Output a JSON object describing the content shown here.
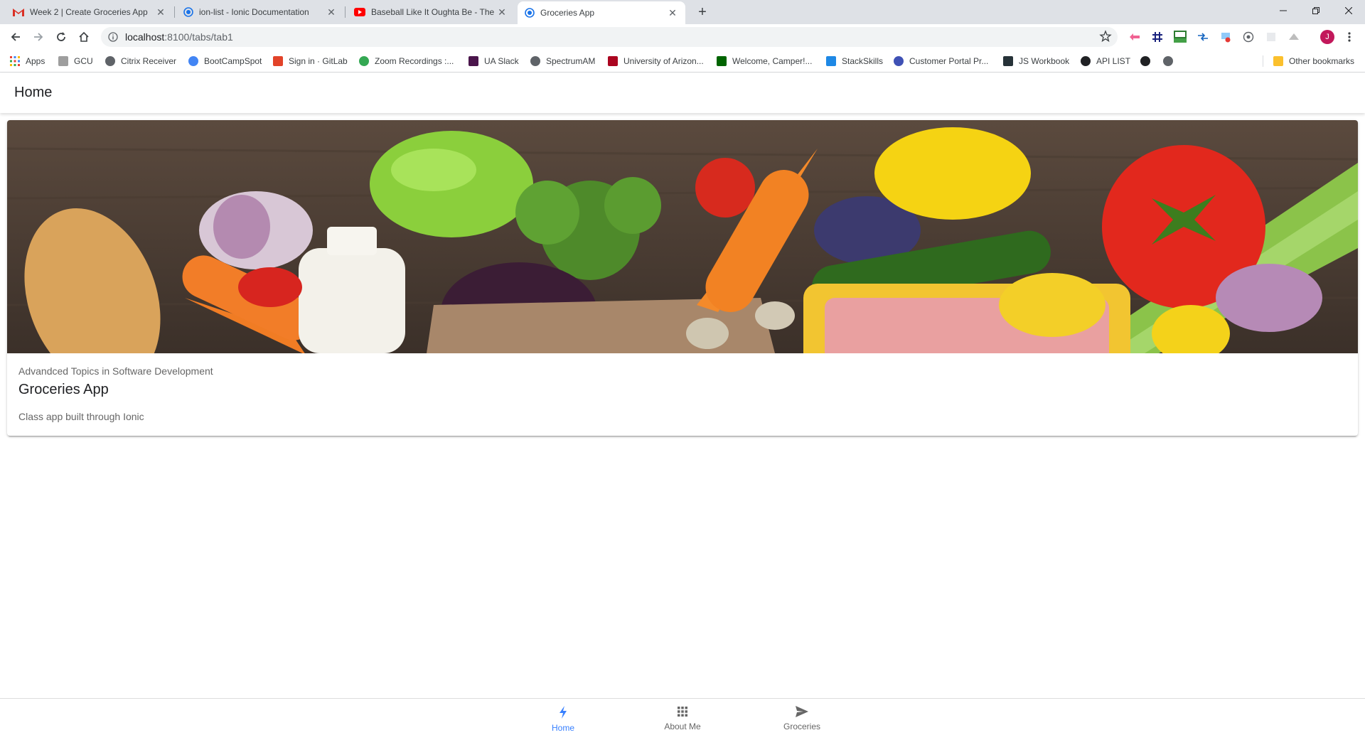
{
  "browser": {
    "tabs": [
      {
        "title": "Week 2 | Create Groceries App",
        "icon": "gmail-icon",
        "active": false
      },
      {
        "title": "ion-list - Ionic Documentation",
        "icon": "chrome-page-icon",
        "active": false
      },
      {
        "title": "Baseball Like It Oughta Be - The",
        "icon": "youtube-icon",
        "active": false
      },
      {
        "title": "Groceries App",
        "icon": "chrome-page-icon",
        "active": true
      }
    ],
    "close_glyph": "✕",
    "new_tab_glyph": "+",
    "url_host": "localhost",
    "url_path": ":8100/tabs/tab1",
    "profile_initial": "J",
    "bookmarks": [
      {
        "label": "Apps",
        "color": "#4285f4"
      },
      {
        "label": "GCU",
        "color": "#9e9e9e"
      },
      {
        "label": "Citrix Receiver",
        "color": "#5f6368"
      },
      {
        "label": "BootCampSpot",
        "color": "#4285f4"
      },
      {
        "label": "Sign in · GitLab",
        "color": "#e24329"
      },
      {
        "label": "Zoom Recordings :...",
        "color": "#34a853"
      },
      {
        "label": "UA Slack",
        "color": "#4a154b"
      },
      {
        "label": "SpectrumAM",
        "color": "#5f6368"
      },
      {
        "label": "University of Arizon...",
        "color": "#ab0520"
      },
      {
        "label": "Welcome, Camper!...",
        "color": "#006400"
      },
      {
        "label": "StackSkills",
        "color": "#1e88e5"
      },
      {
        "label": "Customer Portal Pr...",
        "color": "#3f51b5"
      },
      {
        "label": "JS Workbook",
        "color": "#263238"
      },
      {
        "label": "API LIST",
        "color": "#202124"
      },
      {
        "label": "Other bookmarks",
        "color": "#fbc02d"
      }
    ]
  },
  "app": {
    "header_title": "Home",
    "card": {
      "subtitle": "Advandced Topics in Software Development",
      "title": "Groceries App",
      "content": "Class app built through Ionic"
    },
    "tabs": [
      {
        "label": "Home",
        "icon": "flash-icon",
        "selected": true
      },
      {
        "label": "About Me",
        "icon": "apps-grid-icon",
        "selected": false
      },
      {
        "label": "Groceries",
        "icon": "send-icon",
        "selected": false
      }
    ],
    "accent_color": "#3880ff"
  }
}
